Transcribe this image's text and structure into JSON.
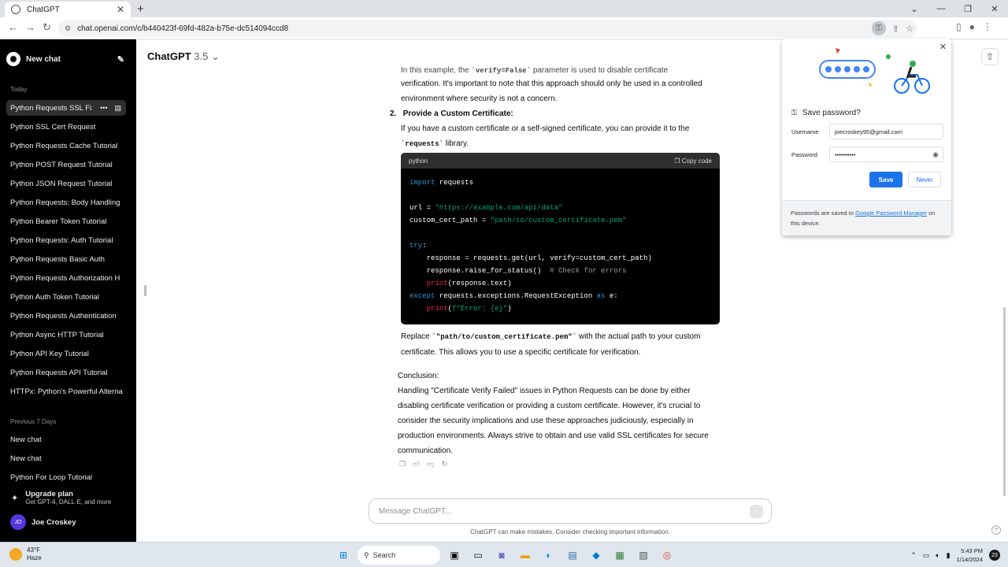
{
  "browser": {
    "tab_title": "ChatGPT",
    "new_tab": "+",
    "url": "chat.openai.com/c/b440423f-69fd-482a-b75e-dc514094ccd8"
  },
  "sidebar": {
    "new_chat": "New chat",
    "today_label": "Today",
    "today_items": [
      "Python Requests SSL Fix",
      "Python SSL Cert Request",
      "Python Requests Cache Tutorial",
      "Python POST Request Tutorial",
      "Python JSON Request Tutorial",
      "Python Requests: Body Handling",
      "Python Bearer Token Tutorial",
      "Python Requests: Auth Tutorial",
      "Python Requests Basic Auth",
      "Python Requests Authorization H",
      "Python Auth Token Tutorial",
      "Python Requests Authentication",
      "Python Async HTTP Tutorial",
      "Python API Key Tutorial",
      "Python Requests API Tutorial",
      "HTTPx: Python's Powerful Alterna"
    ],
    "prev7_label": "Previous 7 Days",
    "prev7_items": [
      "New chat",
      "New chat",
      "Python For Loop Tutorial"
    ],
    "upgrade_title": "Upgrade plan",
    "upgrade_sub": "Get GPT-4, DALL·E, and more",
    "user_initials": "JO",
    "user_name": "Joe Croskey"
  },
  "main": {
    "model": "ChatGPT",
    "model_version": "3.5",
    "cut_line_pre": "In this example, the ",
    "cut_line_code": "`verify=False`",
    "cut_line_post": " parameter is used to disable certificate",
    "para1_rest": "verification. It's important to note that this approach should only be used in a controlled environment where security is not a concern.",
    "item_number": "2.",
    "item_heading": "Provide a Custom Certificate:",
    "item_text_pre": "If you have a custom certificate or a self-signed certificate, you can provide it to the ",
    "item_text_code": "`requests`",
    "item_text_post": " library.",
    "code_lang": "python",
    "copy_code": "Copy code",
    "replace_pre": "Replace ",
    "replace_code": "`\"path/to/custom_certificate.pem\"`",
    "replace_post": " with the actual path to your custom certificate. This allows you to use a specific certificate for verification.",
    "conclusion_label": "Conclusion:",
    "conclusion_text": "Handling \"Certificate Verify Failed\" issues in Python Requests can be done by either disabling certificate verification or providing a custom certificate. However, it's crucial to consider the security implications and use these approaches judiciously, especially in production environments. Always strive to obtain and use valid SSL certificates for secure communication.",
    "composer_placeholder": "Message ChatGPT...",
    "disclaimer": "ChatGPT can make mistakes. Consider checking important information.",
    "help": "?"
  },
  "code": {
    "l1_kw": "import",
    "l1_rest": " requests",
    "l3_pre": "url = ",
    "l3_str": "\"https://example.com/api/data\"",
    "l4_pre": "custom_cert_path = ",
    "l4_str": "\"path/to/custom_certificate.pem\"",
    "l6_kw": "try",
    "l6_rest": ":",
    "l7": "    response = requests.get(url, verify=custom_cert_path)",
    "l8_pre": "    response.raise_for_status()  ",
    "l8_cmt": "# Check for errors",
    "l9_fn": "    print",
    "l9_rest": "(response.text)",
    "l10_kw": "except",
    "l10_mid": " requests.exceptions.RequestException ",
    "l10_kw2": "as",
    "l10_rest": " e:",
    "l11_fn": "    print",
    "l11_p1": "(",
    "l11_str": "f\"Error: {e}\"",
    "l11_p2": ")"
  },
  "password_popup": {
    "title": "Save password?",
    "username_label": "Username",
    "username_value": "joecroskey95@gmail.com",
    "password_label": "Password",
    "password_value": "••••••••••",
    "save": "Save",
    "never": "Never",
    "foot_pre": "Passwords are saved to ",
    "foot_link": "Google Password Manager",
    "foot_post": " on this device."
  },
  "taskbar": {
    "temp": "43°F",
    "weather": "Haze",
    "weather_badge": "1",
    "search": "Search",
    "time": "5:43 PM",
    "date": "1/14/2024",
    "notif_count": "23"
  },
  "colors": {
    "sidebar_bg": "#000000",
    "save_button": "#1a73e8",
    "code_keyword": "#2e95d3",
    "code_string": "#00a67d"
  }
}
